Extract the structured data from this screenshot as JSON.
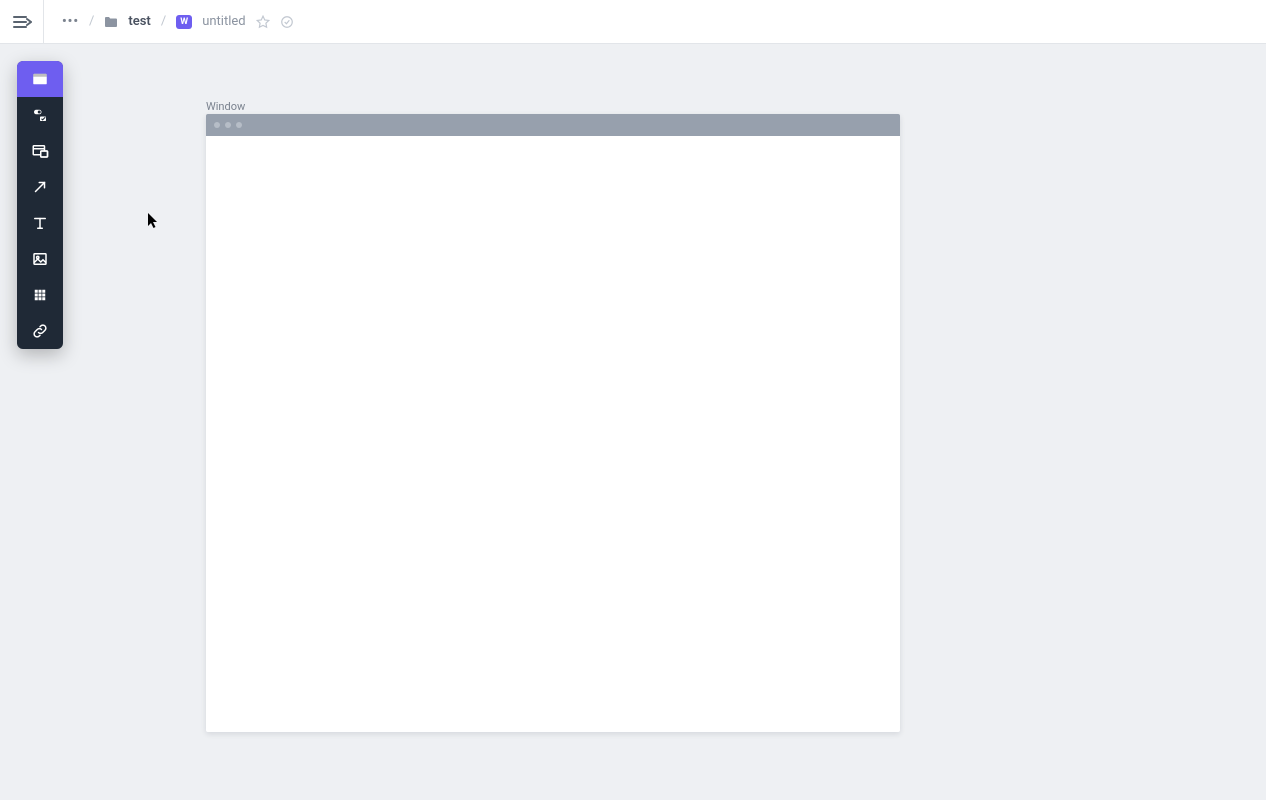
{
  "header": {
    "breadcrumb": {
      "ellipsis": "•••",
      "folder": "test",
      "doc_badge": "W",
      "doc_name": "untitled"
    }
  },
  "toolbar": {
    "tools": [
      {
        "name": "window-tool",
        "active": true
      },
      {
        "name": "controls-tool",
        "active": false
      },
      {
        "name": "browser-tool",
        "active": false
      },
      {
        "name": "arrow-tool",
        "active": false
      },
      {
        "name": "text-tool",
        "active": false
      },
      {
        "name": "image-tool",
        "active": false
      },
      {
        "name": "grid-tool",
        "active": false
      },
      {
        "name": "link-tool",
        "active": false
      }
    ]
  },
  "canvas": {
    "element_label": "Window"
  }
}
